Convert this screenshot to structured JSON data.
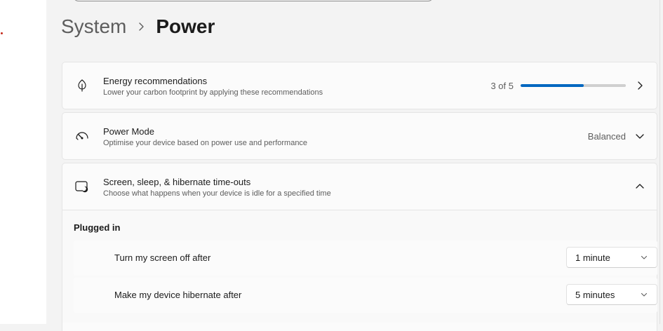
{
  "breadcrumb": {
    "parent": "System",
    "current": "Power"
  },
  "energy": {
    "title": "Energy recommendations",
    "subtitle": "Lower your carbon footprint by applying these recommendations",
    "progress_label": "3 of 5",
    "progress_fraction": 0.6,
    "icon": "leaf-icon"
  },
  "power_mode": {
    "title": "Power Mode",
    "subtitle": "Optimise your device based on power use and performance",
    "value": "Balanced",
    "icon": "gauge-icon"
  },
  "timeouts": {
    "title": "Screen, sleep, & hibernate time-outs",
    "subtitle": "Choose what happens when your device is idle for a specified time",
    "icon": "screen-sleep-icon",
    "section_title": "Plugged in",
    "rows": [
      {
        "label": "Turn my screen off after",
        "value": "1 minute"
      },
      {
        "label": "Make my device hibernate after",
        "value": "5 minutes"
      }
    ]
  },
  "colors": {
    "accent": "#0067c0",
    "track": "#cfcfcf",
    "background": "#f3f3f3",
    "card": "#fbfbfb"
  }
}
